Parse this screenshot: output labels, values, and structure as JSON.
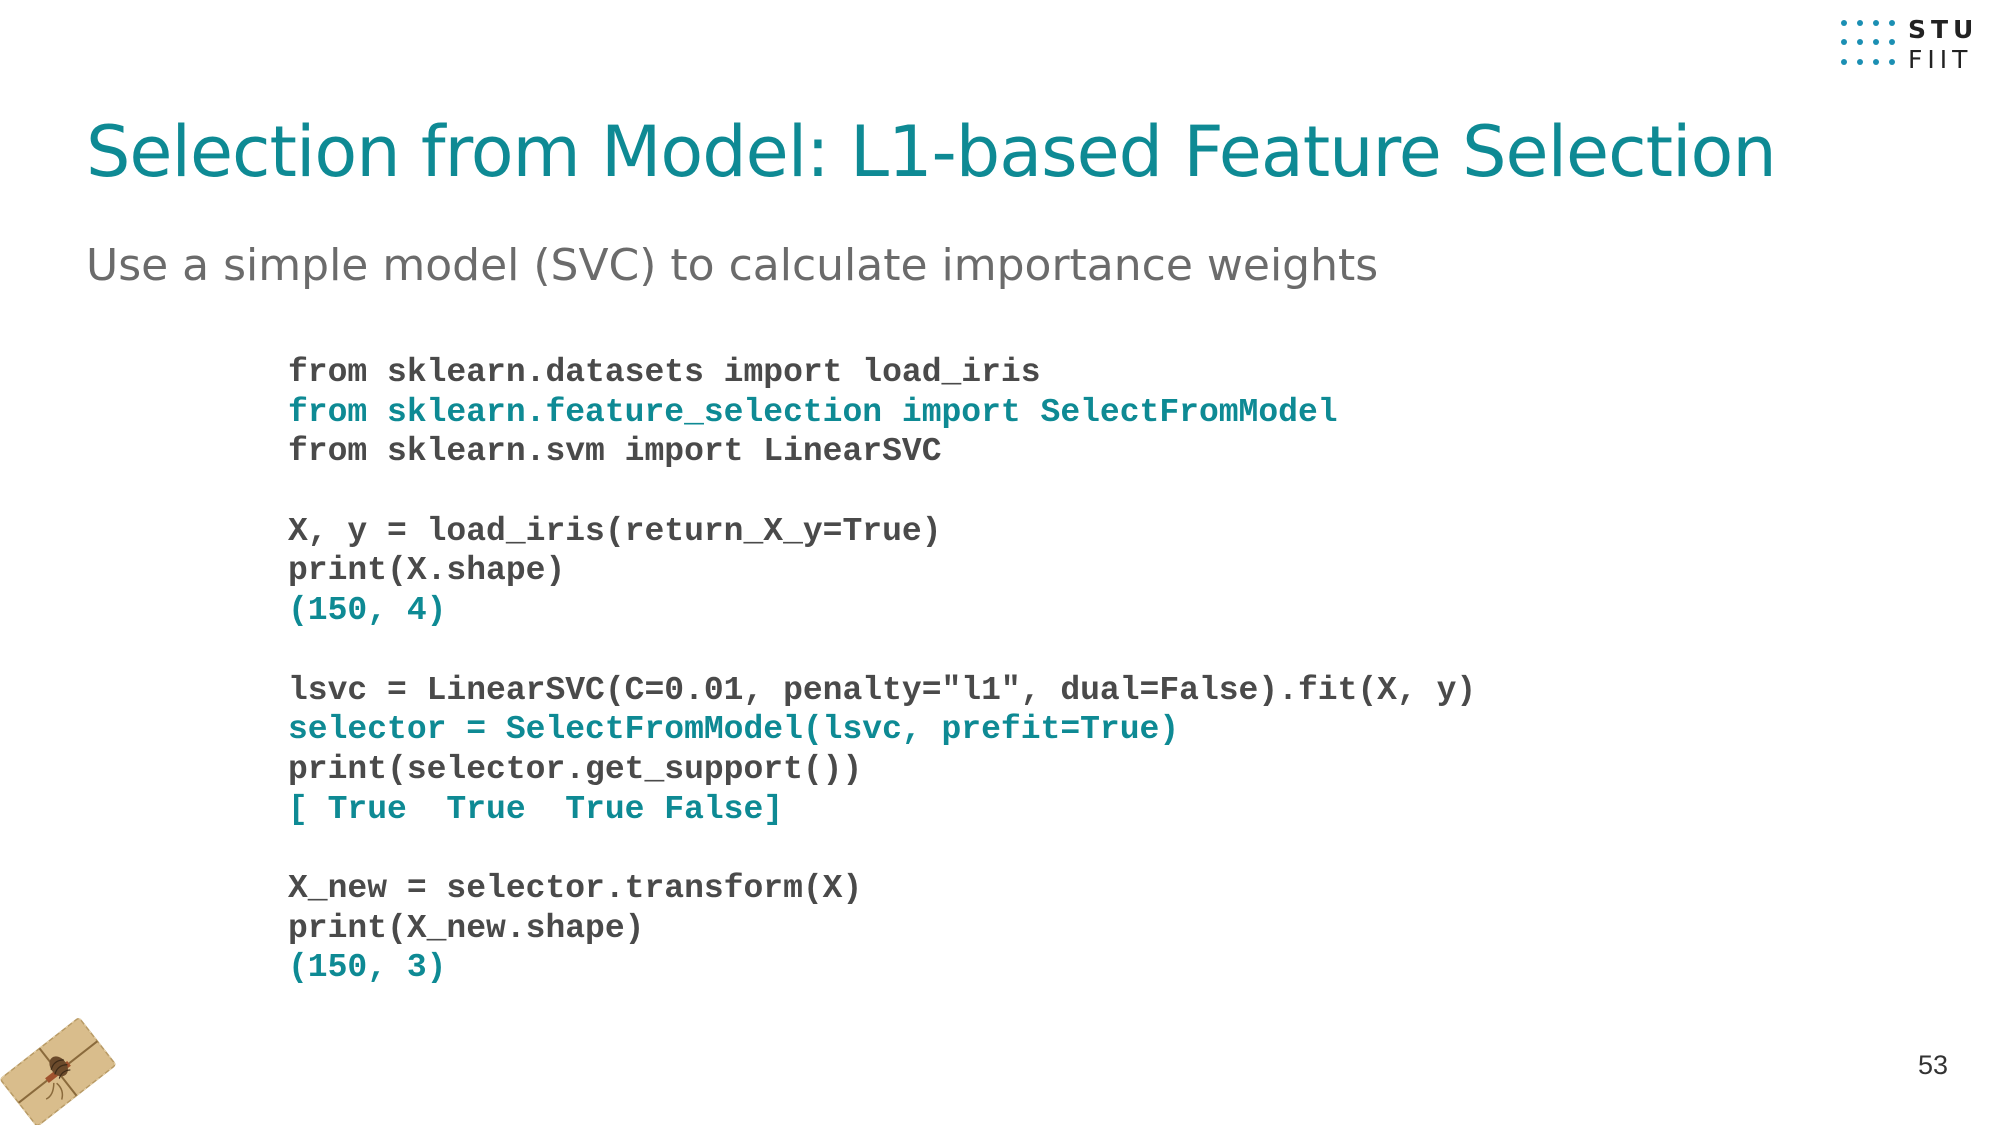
{
  "slide": {
    "title": "Selection from Model: L1-based Feature Selection",
    "subtitle": "Use a simple model (SVC) to calculate importance weights",
    "page_number": "53",
    "logo": {
      "line1": "STU",
      "line2": "FIIT",
      "icon": "dot-grid-icon"
    },
    "decoration_icon": "gift-package-icon"
  },
  "colors": {
    "accent": "#0e8a94",
    "code_gray": "#4a4a4a",
    "subtitle_gray": "#6b6b6b"
  },
  "code": [
    {
      "text": "from sklearn.datasets import load_iris",
      "style": "gray"
    },
    {
      "text": "from sklearn.feature_selection import SelectFromModel",
      "style": "teal"
    },
    {
      "text": "from sklearn.svm import LinearSVC",
      "style": "gray"
    },
    {
      "text": "",
      "style": "gray"
    },
    {
      "text": "X, y = load_iris(return_X_y=True)",
      "style": "gray"
    },
    {
      "text": "print(X.shape)",
      "style": "gray"
    },
    {
      "text": "(150, 4)",
      "style": "teal"
    },
    {
      "text": "",
      "style": "gray"
    },
    {
      "text": "lsvc = LinearSVC(C=0.01, penalty=\"l1\", dual=False).fit(X, y)",
      "style": "gray"
    },
    {
      "text": "selector = SelectFromModel(lsvc, prefit=True)",
      "style": "teal"
    },
    {
      "text": "print(selector.get_support())",
      "style": "gray"
    },
    {
      "text": "[ True  True  True False]",
      "style": "teal"
    },
    {
      "text": "",
      "style": "gray"
    },
    {
      "text": "X_new = selector.transform(X)",
      "style": "gray"
    },
    {
      "text": "print(X_new.shape)",
      "style": "gray"
    },
    {
      "text": "(150, 3)",
      "style": "teal"
    }
  ]
}
